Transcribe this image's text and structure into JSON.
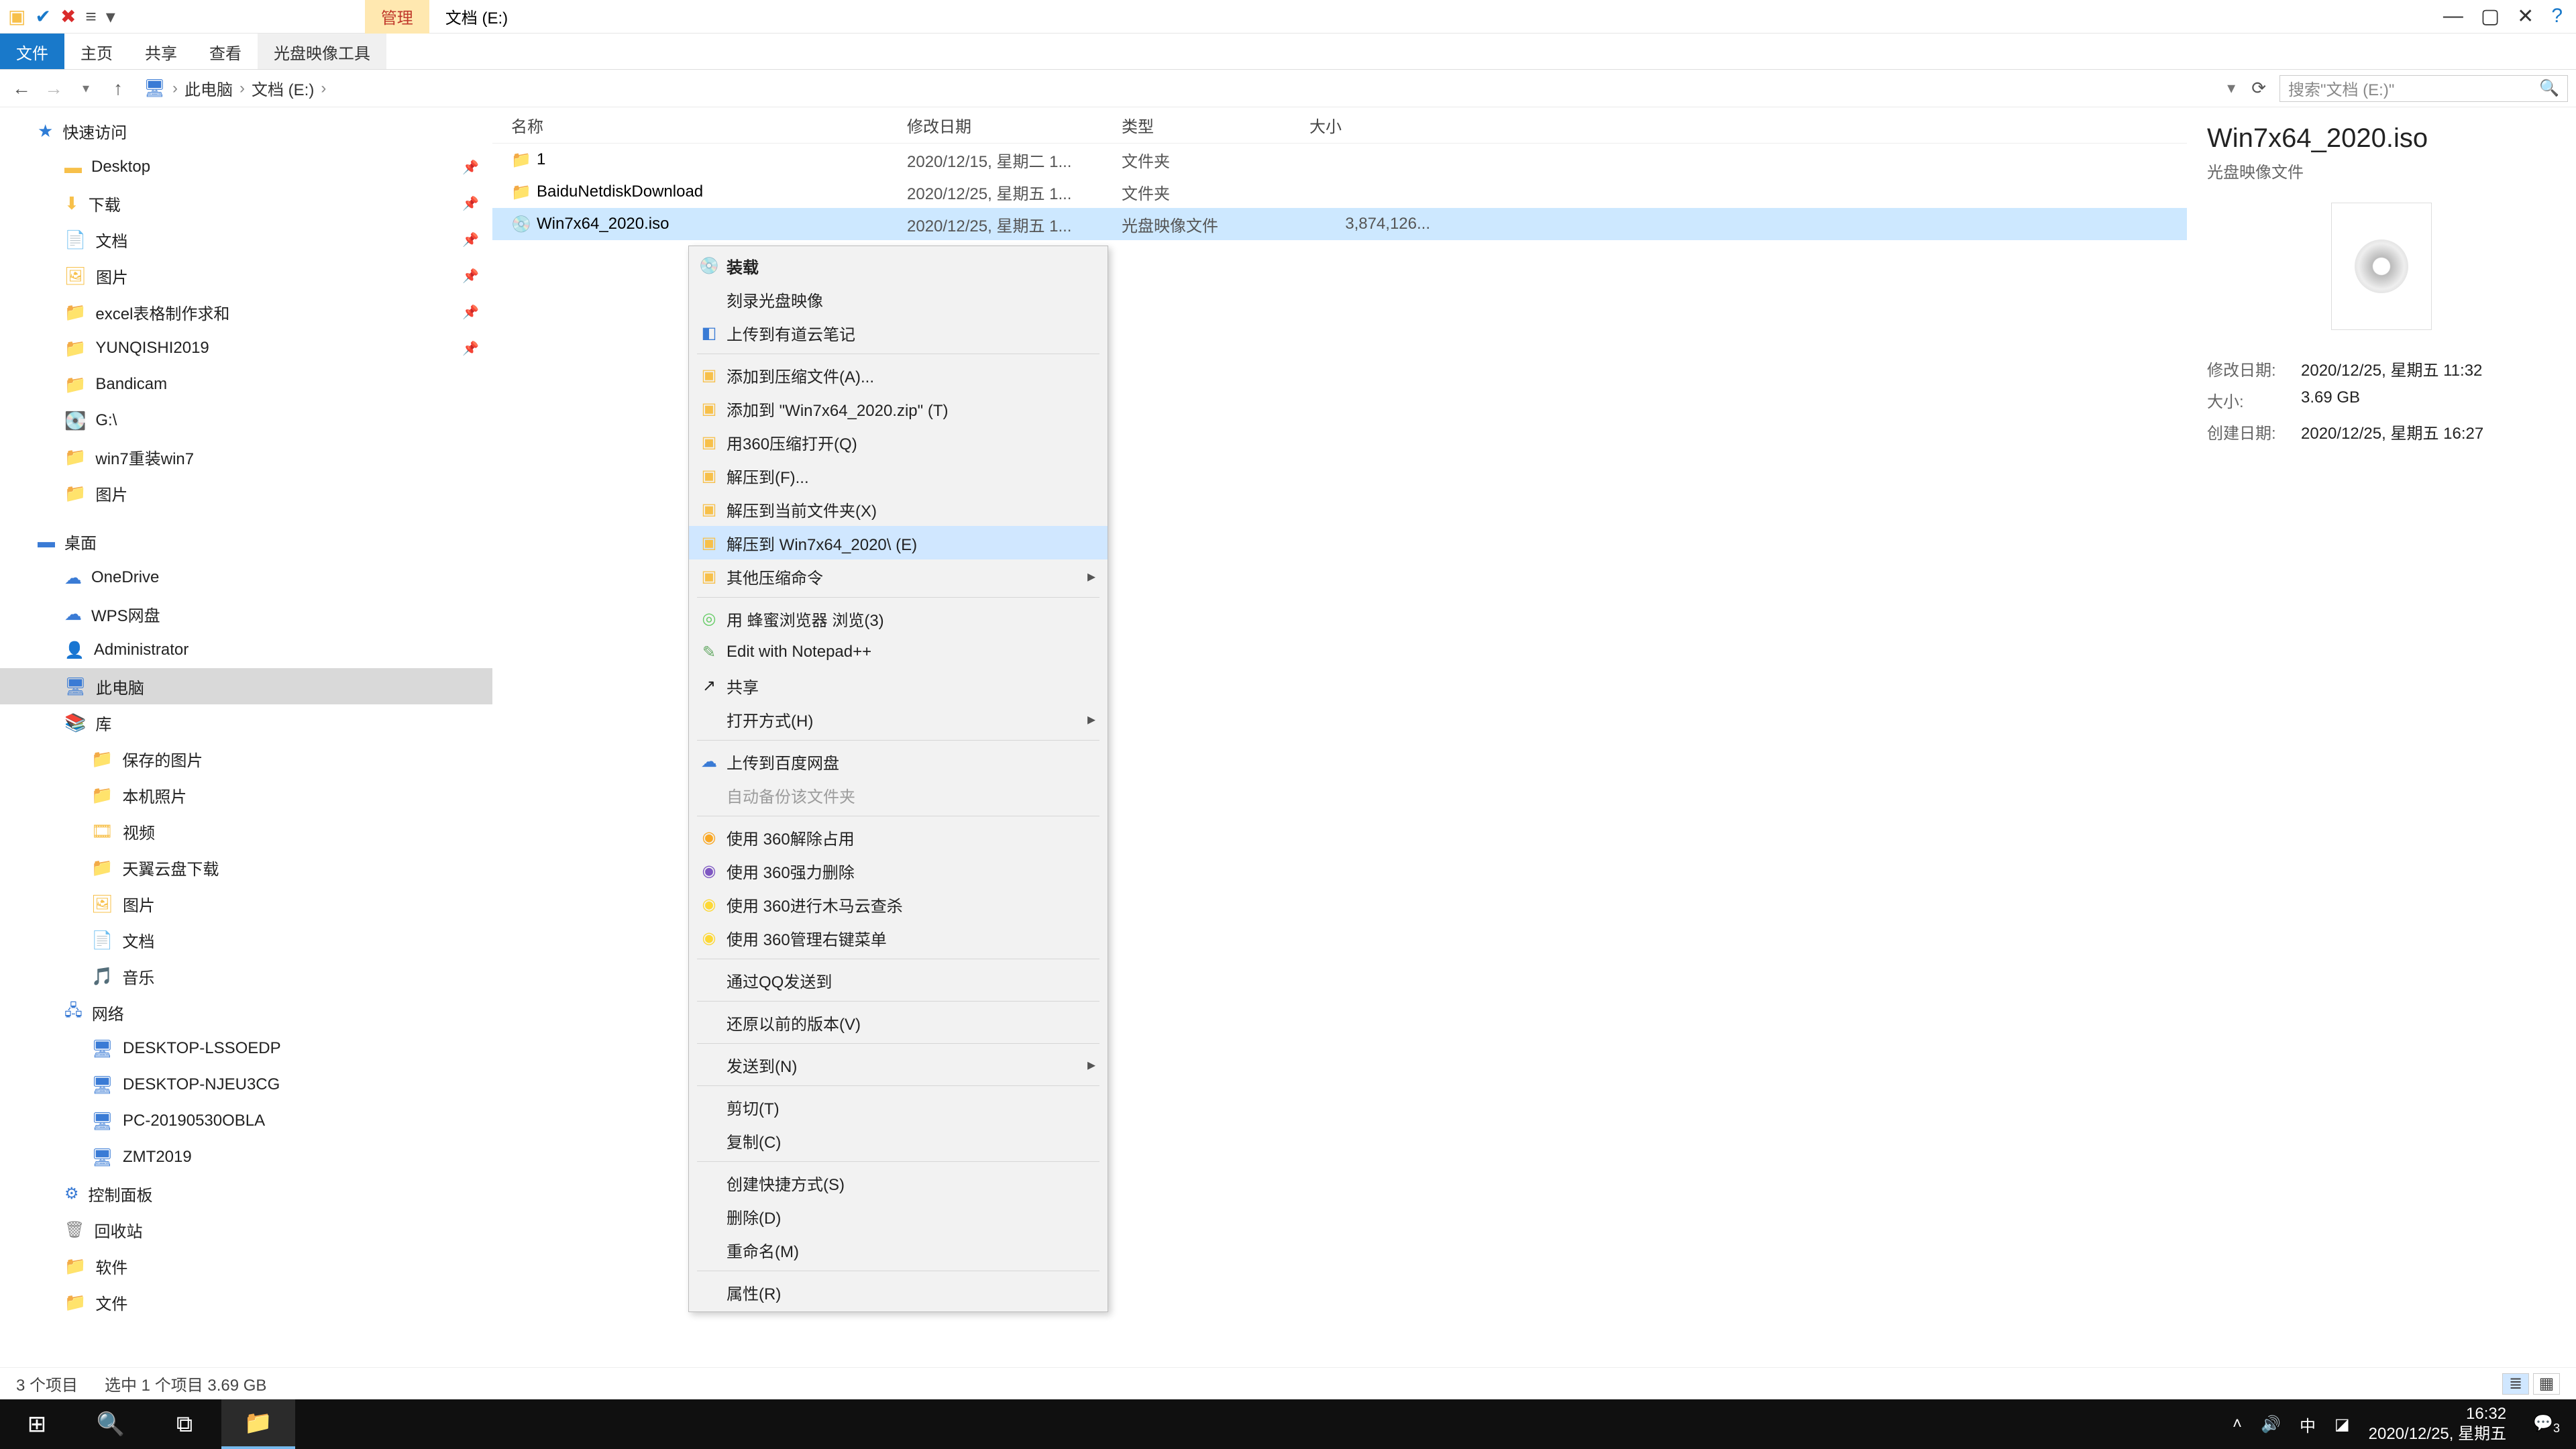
{
  "titlebar": {
    "qat_icons": [
      "folder-icon",
      "check-icon",
      "x-red-icon",
      "eq-icon",
      "dropdown-icon"
    ],
    "tab_manage": "管理",
    "tab_location": "文档 (E:)"
  },
  "ribbon": {
    "file": "文件",
    "home": "主页",
    "share": "共享",
    "view": "查看",
    "disc_tools": "光盘映像工具"
  },
  "address": {
    "root": "此电脑",
    "loc": "文档 (E:)",
    "search_placeholder": "搜索\"文档 (E:)\""
  },
  "tree": {
    "quick": "快速访问",
    "items1": [
      "Desktop",
      "下载",
      "文档",
      "图片",
      "excel表格制作求和",
      "YUNQISHI2019",
      "Bandicam",
      "G:\\",
      "win7重装win7",
      "图片"
    ],
    "desktop": "桌面",
    "items2": [
      "OneDrive",
      "WPS网盘",
      "Administrator",
      "此电脑",
      "库"
    ],
    "lib": [
      "保存的图片",
      "本机照片",
      "视频",
      "天翼云盘下载",
      "图片",
      "文档",
      "音乐"
    ],
    "network": "网络",
    "nets": [
      "DESKTOP-LSSOEDP",
      "DESKTOP-NJEU3CG",
      "PC-20190530OBLA",
      "ZMT2019"
    ],
    "cpl": "控制面板",
    "recycle": "回收站",
    "soft": "软件",
    "files": "文件"
  },
  "columns": {
    "name": "名称",
    "date": "修改日期",
    "type": "类型",
    "size": "大小"
  },
  "rows": [
    {
      "name": "1",
      "date": "2020/12/15, 星期二 1...",
      "type": "文件夹",
      "size": ""
    },
    {
      "name": "BaiduNetdiskDownload",
      "date": "2020/12/25, 星期五 1...",
      "type": "文件夹",
      "size": ""
    },
    {
      "name": "Win7x64_2020.iso",
      "date": "2020/12/25, 星期五 1...",
      "type": "光盘映像文件",
      "size": "3,874,126..."
    }
  ],
  "ctx": {
    "mount": "装载",
    "burn": "刻录光盘映像",
    "youdao": "上传到有道云笔记",
    "addarc": "添加到压缩文件(A)...",
    "addzip": "添加到 \"Win7x64_2020.zip\" (T)",
    "open360": "用360压缩打开(Q)",
    "extractF": "解压到(F)...",
    "extractCur": "解压到当前文件夹(X)",
    "extractNamed": "解压到 Win7x64_2020\\ (E)",
    "otherarc": "其他压缩命令",
    "bee": "用 蜂蜜浏览器 浏览(3)",
    "npp": "Edit with Notepad++",
    "share": "共享",
    "openwith": "打开方式(H)",
    "baidu": "上传到百度网盘",
    "autobak": "自动备份该文件夹",
    "u360_unlock": "使用 360解除占用",
    "u360_del": "使用 360强力删除",
    "u360_scan": "使用 360进行木马云查杀",
    "u360_menu": "使用 360管理右键菜单",
    "qq": "通过QQ发送到",
    "restore": "还原以前的版本(V)",
    "sendto": "发送到(N)",
    "cut": "剪切(T)",
    "copy": "复制(C)",
    "shortcut": "创建快捷方式(S)",
    "delete": "删除(D)",
    "rename": "重命名(M)",
    "props": "属性(R)"
  },
  "details": {
    "name": "Win7x64_2020.iso",
    "type": "光盘映像文件",
    "k_mod": "修改日期:",
    "v_mod": "2020/12/25, 星期五 11:32",
    "k_size": "大小:",
    "v_size": "3.69 GB",
    "k_created": "创建日期:",
    "v_created": "2020/12/25, 星期五 16:27"
  },
  "status": {
    "count": "3 个项目",
    "selected": "选中 1 个项目  3.69 GB"
  },
  "taskbar": {
    "ime": "中",
    "time": "16:32",
    "date": "2020/12/25, 星期五",
    "badge": "3"
  }
}
